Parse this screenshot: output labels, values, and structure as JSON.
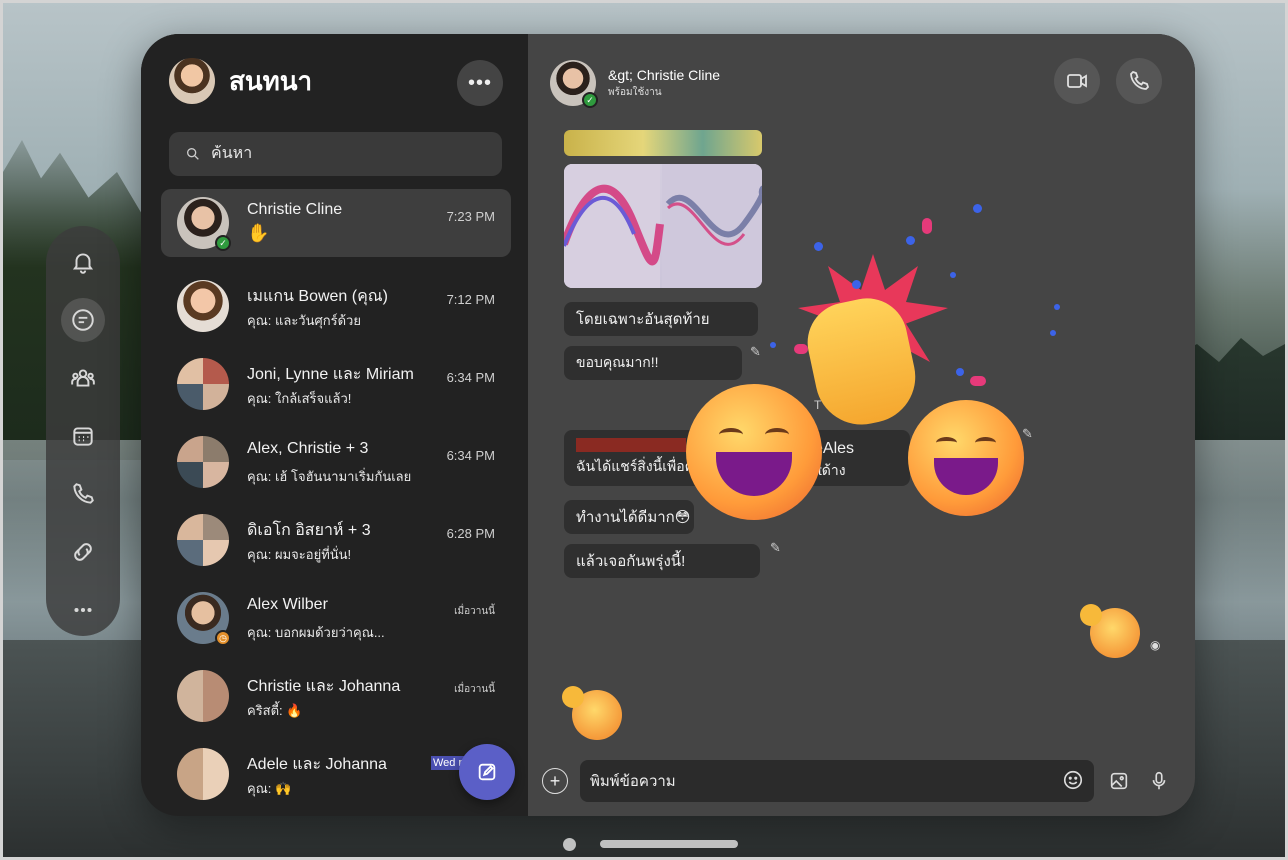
{
  "sidebar": {
    "title": "สนทนา",
    "search_placeholder": "ค้นหา",
    "conversations": [
      {
        "name": "Christie Cline",
        "time": "7:23 PM",
        "preview": "✋",
        "status": "available"
      },
      {
        "name": "เมแกน Bowen (คุณ)",
        "time": "7:12 PM",
        "preview": "คุณ: และวันศุกร์ด้วย"
      },
      {
        "name": "Joni, Lynne และ Miriam",
        "time": "6:34 PM",
        "preview": "คุณ: ใกล้เสร็จแล้ว!"
      },
      {
        "name": "Alex, Christie + 3",
        "time": "6:34 PM",
        "preview": "คุณ: เฮ้ โจฮันนามาเริ่มกันเลย"
      },
      {
        "name": "ดิเอโก อิสยาห์ + 3",
        "time": "6:28 PM",
        "preview": "คุณ: ผมจะอยู่ที่นั่น!"
      },
      {
        "name": "Alex Wilber",
        "time": "เมื่อวานนี้",
        "preview": "คุณ: บอกผมด้วยว่าคุณ...",
        "status": "away"
      },
      {
        "name": "Christie และ Johanna",
        "time": "เมื่อวานนี้",
        "preview": "คริสตี้: 🔥"
      },
      {
        "name": "Adele และ Johanna",
        "time": "Wed r",
        "preview": "คุณ: 🙌"
      }
    ]
  },
  "chat": {
    "contact_name": "&gt; Christie Cline",
    "contact_status": "พร้อมใช้งาน",
    "messages": [
      {
        "text": "โดยเฉพาะอันสุดท้าย"
      },
      {
        "text": "ขอบคุณมาก!!"
      },
      {
        "text": "ฉันได้แชร์สิ่งนี้เพื่อค้นหาทีม"
      },
      {
        "text": "eAles"
      },
      {
        "text": "ttด้าง"
      },
      {
        "text": "ทำงานได้ดีมาก😳"
      },
      {
        "text": "แล้วเจอกันพรุ่งนี้!"
      }
    ],
    "partial_letter": "T",
    "composer_placeholder": "พิมพ์ข้อความ"
  },
  "icons": {
    "rail": [
      "bell-icon",
      "chat-icon",
      "teams-icon",
      "calendar-icon",
      "phone-icon",
      "loop-icon",
      "more-icon"
    ],
    "header": [
      "video-icon",
      "call-icon"
    ],
    "composer": [
      "add-icon",
      "emoji-icon",
      "image-icon",
      "mic-icon"
    ]
  },
  "colors": {
    "accent": "#5b5fc7",
    "available": "#2f9b3e",
    "away": "#e4902b"
  }
}
